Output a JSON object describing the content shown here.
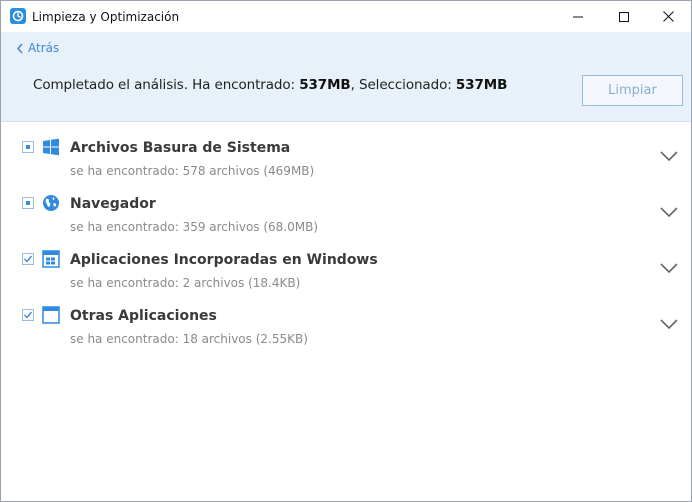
{
  "window": {
    "title": "Limpieza y Optimización",
    "accent": "#3d88d4"
  },
  "header": {
    "back_label": "Atrás",
    "summary_prefix": "Completado el análisis. Ha encontrado: ",
    "found_size": "537MB",
    "summary_middle": ", Seleccionado: ",
    "selected_size": "537MB",
    "clean_button": "Limpiar"
  },
  "items": [
    {
      "title": "Archivos Basura de Sistema",
      "subtitle": "se ha encontrado: 578 archivos (469MB)",
      "icon": "windows-logo-icon",
      "check": "partial"
    },
    {
      "title": "Navegador",
      "subtitle": "se ha encontrado: 359 archivos (68.0MB)",
      "icon": "globe-icon",
      "check": "partial"
    },
    {
      "title": "Aplicaciones Incorporadas en Windows",
      "subtitle": "se ha encontrado: 2 archivos (18.4KB)",
      "icon": "windows-app-icon",
      "check": "checked"
    },
    {
      "title": "Otras Aplicaciones",
      "subtitle": "se ha encontrado: 18 archivos (2.55KB)",
      "icon": "app-window-icon",
      "check": "checked"
    }
  ]
}
